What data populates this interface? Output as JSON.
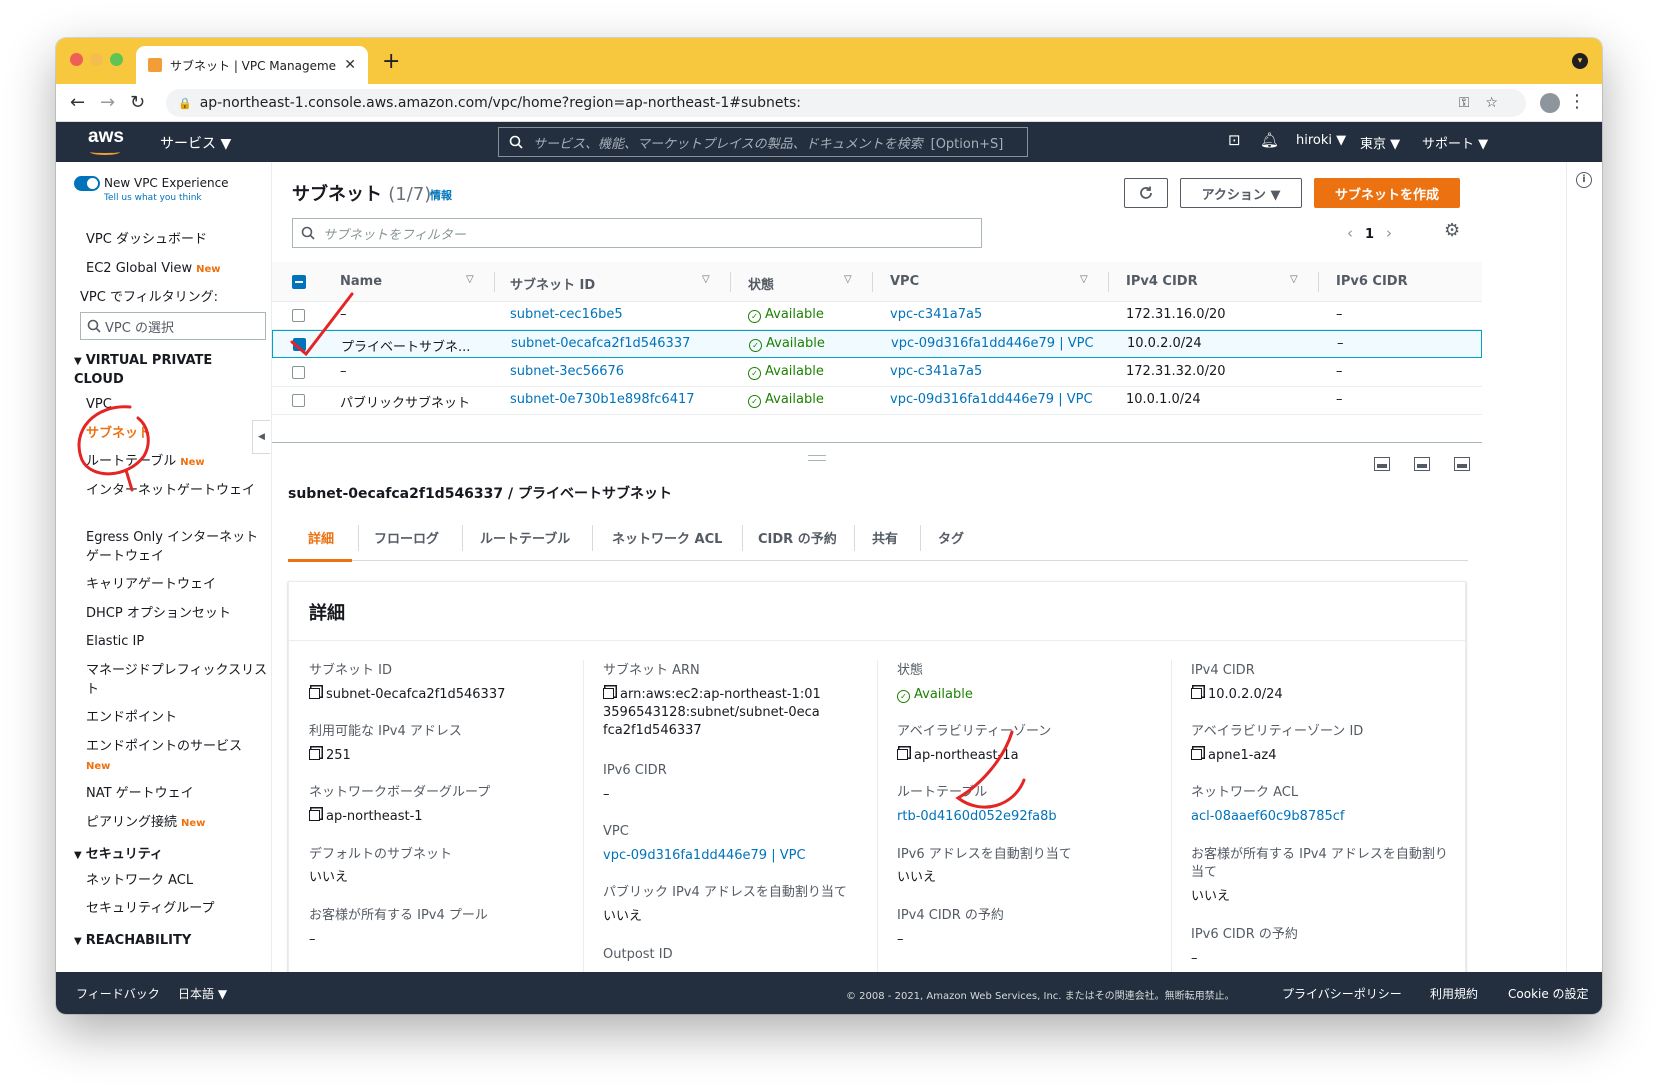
{
  "browser": {
    "tab_title": "サブネット | VPC Management C",
    "url": "ap-northeast-1.console.aws.amazon.com/vpc/home?region=ap-northeast-1#subnets:"
  },
  "awsnav": {
    "logo": "aws",
    "services": "サービス ▼",
    "search_placeholder": "サービス、機能、マーケットプレイスの製品、ドキュメントを検索",
    "search_shortcut": "[Option+S]",
    "user": "hiroki ▼",
    "region": "東京 ▼",
    "support": "サポート ▼"
  },
  "sidebar": {
    "new_vpc": "New VPC Experience",
    "tell_us": "Tell us what you think",
    "dashboard": "VPC ダッシュボード",
    "ec2_global": "EC2 Global View",
    "new": "New",
    "filter_label": "VPC でフィルタリング:",
    "vpc_select": "VPC の選択",
    "section_vpc": "VIRTUAL PRIVATE CLOUD",
    "vpc": "VPC",
    "subnets": "サブネット",
    "route_tables": "ルートテーブル",
    "igw": "インターネットゲートウェイ",
    "egress": "Egress Only インターネットゲートウェイ",
    "carrier": "キャリアゲートウェイ",
    "dhcp": "DHCP オプションセット",
    "eip": "Elastic IP",
    "prefix": "マネージドプレフィックスリスト",
    "endpoints": "エンドポイント",
    "endpoint_services": "エンドポイントのサービス",
    "nat": "NAT ゲートウェイ",
    "peering": "ピアリング接続",
    "section_security": "セキュリティ",
    "nacl": "ネットワーク ACL",
    "sg": "セキュリティグループ",
    "section_reach": "REACHABILITY"
  },
  "main": {
    "title": "サブネット",
    "count": "(1/7)",
    "info": "情報",
    "actions": "アクション ▼",
    "create": "サブネットを作成",
    "filter_placeholder": "サブネットをフィルター",
    "page": "1"
  },
  "table": {
    "columns": [
      "Name",
      "サブネット ID",
      "状態",
      "VPC",
      "IPv4 CIDR",
      "IPv6 CIDR"
    ],
    "rows": [
      {
        "name": "–",
        "id": "subnet-cec16be5",
        "state": "Available",
        "vpc": "vpc-c341a7a5",
        "ipv4": "172.31.16.0/20",
        "ipv6": "–"
      },
      {
        "name": "プライベートサブネ...",
        "id": "subnet-0ecafca2f1d546337",
        "state": "Available",
        "vpc": "vpc-09d316fa1dd446e79 | VPC",
        "ipv4": "10.0.2.0/24",
        "ipv6": "–"
      },
      {
        "name": "–",
        "id": "subnet-3ec56676",
        "state": "Available",
        "vpc": "vpc-c341a7a5",
        "ipv4": "172.31.32.0/20",
        "ipv6": "–"
      },
      {
        "name": "パブリックサブネット",
        "id": "subnet-0e730b1e898fc6417",
        "state": "Available",
        "vpc": "vpc-09d316fa1dd446e79 | VPC",
        "ipv4": "10.0.1.0/24",
        "ipv6": "–"
      }
    ]
  },
  "detail": {
    "title": "subnet-0ecafca2f1d546337 / プライベートサブネット",
    "tabs": [
      "詳細",
      "フローログ",
      "ルートテーブル",
      "ネットワーク ACL",
      "CIDR の予約",
      "共有",
      "タグ"
    ],
    "card_title": "詳細",
    "c1": {
      "subnet_id_l": "サブネット ID",
      "subnet_id": "subnet-0ecafca2f1d546337",
      "ipv4_avail_l": "利用可能な IPv4 アドレス",
      "ipv4_avail": "251",
      "nbg_l": "ネットワークボーダーグループ",
      "nbg": "ap-northeast-1",
      "default_l": "デフォルトのサブネット",
      "default": "いいえ",
      "pool_l": "お客様が所有する IPv4 プール",
      "pool": "–"
    },
    "c2": {
      "arn_l": "サブネット ARN",
      "arn": "arn:aws:ec2:ap-northeast-1:013596543128:subnet/subnet-0ecafca2f1d546337",
      "ipv6_l": "IPv6 CIDR",
      "ipv6": "–",
      "vpc_l": "VPC",
      "vpc": "vpc-09d316fa1dd446e79 | VPC",
      "public_l": "パブリック IPv4 アドレスを自動割り当て",
      "public": "いいえ",
      "outpost_l": "Outpost ID"
    },
    "c3": {
      "state_l": "状態",
      "state": "Available",
      "az_l": "アベイラビリティーゾーン",
      "az": "ap-northeast-1a",
      "rt_l": "ルートテーブル",
      "rt": "rtb-0d4160d052e92fa8b",
      "ipv6_assign_l": "IPv6 アドレスを自動割り当て",
      "ipv6_assign": "いいえ",
      "reserv_l": "IPv4 CIDR の予約",
      "reserv": "–"
    },
    "c4": {
      "ipv4_l": "IPv4 CIDR",
      "ipv4": "10.0.2.0/24",
      "azid_l": "アベイラビリティーゾーン ID",
      "azid": "apne1-az4",
      "nacl_l": "ネットワーク ACL",
      "nacl": "acl-08aaef60c9b8785cf",
      "cust_l": "お客様が所有する IPv4 アドレスを自動割り当て",
      "cust": "いいえ",
      "ipv6res_l": "IPv6 CIDR の予約",
      "ipv6res": "–"
    }
  },
  "footer": {
    "feedback": "フィードバック",
    "lang": "日本語 ▼",
    "copyright": "© 2008 - 2021, Amazon Web Services, Inc. またはその関連会社。無断転用禁止。",
    "privacy": "プライバシーポリシー",
    "terms": "利用規約",
    "cookie": "Cookie の設定"
  }
}
